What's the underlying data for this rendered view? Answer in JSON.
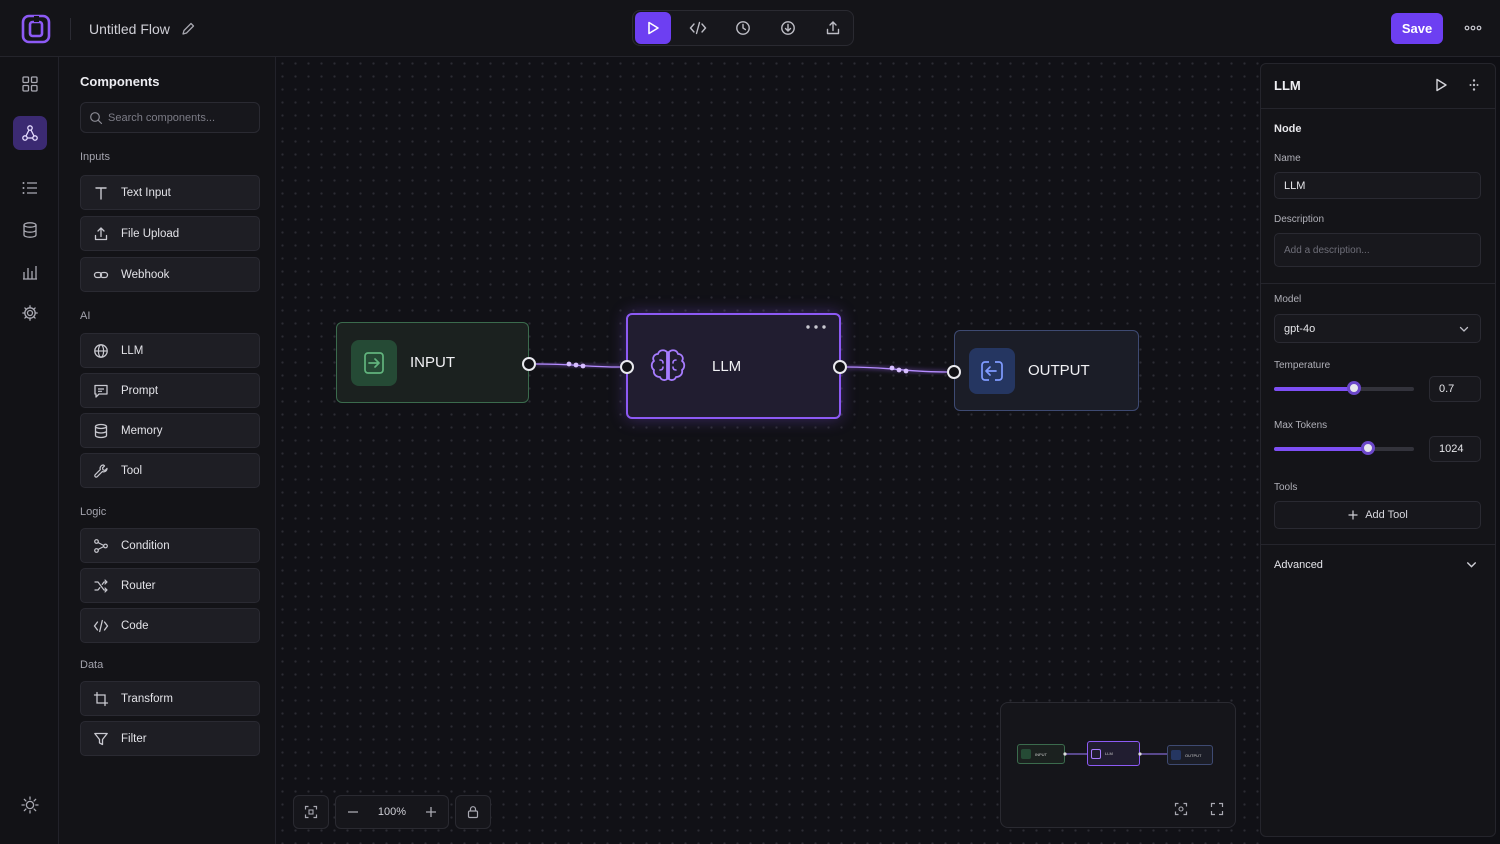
{
  "header": {
    "flow_title": "Untitled Flow",
    "save_label": "Save"
  },
  "toolbar": {
    "buttons": [
      "play-icon",
      "code-icon",
      "history-icon",
      "download-icon",
      "upload-icon"
    ]
  },
  "rail": {
    "items": [
      "grid-icon",
      "flow-icon",
      "list-icon",
      "database-icon",
      "chart-icon",
      "gear-icon"
    ],
    "active": "flow-icon"
  },
  "components": {
    "title": "Components",
    "search_placeholder": "Search components...",
    "groups": [
      {
        "label": "Inputs",
        "items": [
          "Text Input",
          "File Upload",
          "Webhook"
        ]
      },
      {
        "label": "AI",
        "items": [
          "LLM",
          "Prompt",
          "Memory",
          "Tool"
        ]
      },
      {
        "label": "Logic",
        "items": [
          "Condition",
          "Router",
          "Code"
        ]
      },
      {
        "label": "Data",
        "items": [
          "Transform",
          "Filter"
        ]
      }
    ]
  },
  "canvas": {
    "nodes": {
      "input": "INPUT",
      "llm": "LLM",
      "output": "OUTPUT"
    },
    "zoom_level": "100%"
  },
  "minimap": {
    "labels": [
      "INPUT",
      "LLM",
      "OUTPUT"
    ]
  },
  "properties": {
    "title": "LLM",
    "section_node": "Node",
    "name_label": "Name",
    "name_value": "LLM",
    "description_label": "Description",
    "description_placeholder": "Add a description...",
    "model_label": "Model",
    "model_value": "gpt-4o",
    "temperature_label": "Temperature",
    "temperature_value": "0.7",
    "temperature_fraction": 0.57,
    "max_tokens_label": "Max Tokens",
    "max_tokens_value": "1024",
    "max_tokens_fraction": 0.67,
    "tools_label": "Tools",
    "add_tool_label": "Add Tool",
    "advanced_label": "Advanced"
  },
  "colors": {
    "accent": "#6d3ff2",
    "input_node": "#3b6b4d",
    "llm_node": "#8d5af5",
    "output_node": "#3e4a72"
  }
}
